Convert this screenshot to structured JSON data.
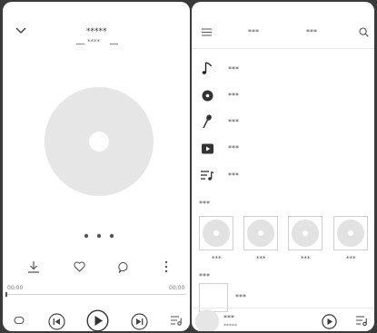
{
  "player": {
    "title": "*****",
    "subtitle": "****",
    "time_current": "00:00",
    "time_total": "00:00",
    "progress": 0
  },
  "library": {
    "tabs": [
      "***",
      "***"
    ],
    "menu": [
      {
        "label": "***",
        "icon": "music-note-icon"
      },
      {
        "label": "***",
        "icon": "disc-icon"
      },
      {
        "label": "***",
        "icon": "microphone-icon"
      },
      {
        "label": "***",
        "icon": "video-play-icon"
      },
      {
        "label": "***",
        "icon": "playlist-icon"
      }
    ],
    "albums_heading": "***",
    "albums": [
      {
        "label": "***"
      },
      {
        "label": "***"
      },
      {
        "label": "***"
      },
      {
        "label": "***"
      }
    ],
    "playlists_heading": "***",
    "playlist_item": "***",
    "mini_player": {
      "title": "***",
      "subtitle": "*****"
    }
  }
}
